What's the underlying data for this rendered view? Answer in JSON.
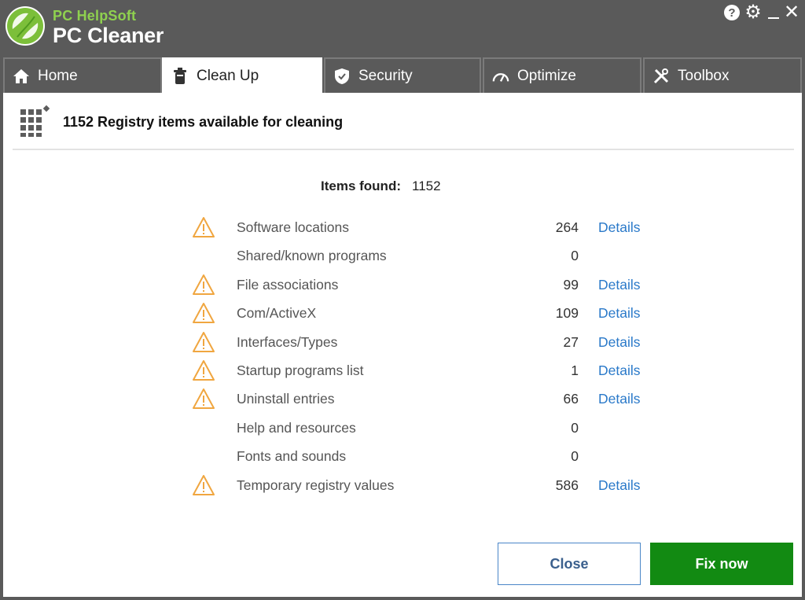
{
  "app": {
    "brand_sub": "PC HelpSoft",
    "brand_main": "PC Cleaner"
  },
  "window_controls": {
    "help": "?",
    "settings": "⚙",
    "close": "✕"
  },
  "tabs": [
    {
      "label": "Home",
      "icon": "home-icon",
      "active": false
    },
    {
      "label": "Clean Up",
      "icon": "cleanup-icon",
      "active": true
    },
    {
      "label": "Security",
      "icon": "shield-icon",
      "active": false
    },
    {
      "label": "Optimize",
      "icon": "speedometer-icon",
      "active": false
    },
    {
      "label": "Toolbox",
      "icon": "tools-icon",
      "active": false
    }
  ],
  "header": {
    "title": "1152 Registry items available for cleaning",
    "icon": "registry-grid-icon"
  },
  "summary": {
    "label": "Items found:",
    "value": "1152"
  },
  "items": [
    {
      "label": "Software locations",
      "count": "264",
      "warning": true,
      "details": "Details"
    },
    {
      "label": "Shared/known programs",
      "count": "0",
      "warning": false,
      "details": ""
    },
    {
      "label": "File associations",
      "count": "99",
      "warning": true,
      "details": "Details"
    },
    {
      "label": "Com/ActiveX",
      "count": "109",
      "warning": true,
      "details": "Details"
    },
    {
      "label": "Interfaces/Types",
      "count": "27",
      "warning": true,
      "details": "Details"
    },
    {
      "label": "Startup programs list",
      "count": "1",
      "warning": true,
      "details": "Details"
    },
    {
      "label": "Uninstall entries",
      "count": "66",
      "warning": true,
      "details": "Details"
    },
    {
      "label": "Help and resources",
      "count": "0",
      "warning": false,
      "details": ""
    },
    {
      "label": "Fonts and sounds",
      "count": "0",
      "warning": false,
      "details": ""
    },
    {
      "label": "Temporary registry values",
      "count": "586",
      "warning": true,
      "details": "Details"
    }
  ],
  "buttons": {
    "close": "Close",
    "fix": "Fix now"
  },
  "colors": {
    "titlebar": "#5a5a5a",
    "accent_green": "#128a12",
    "link_blue": "#2a79c9",
    "warning": "#f0a640"
  }
}
